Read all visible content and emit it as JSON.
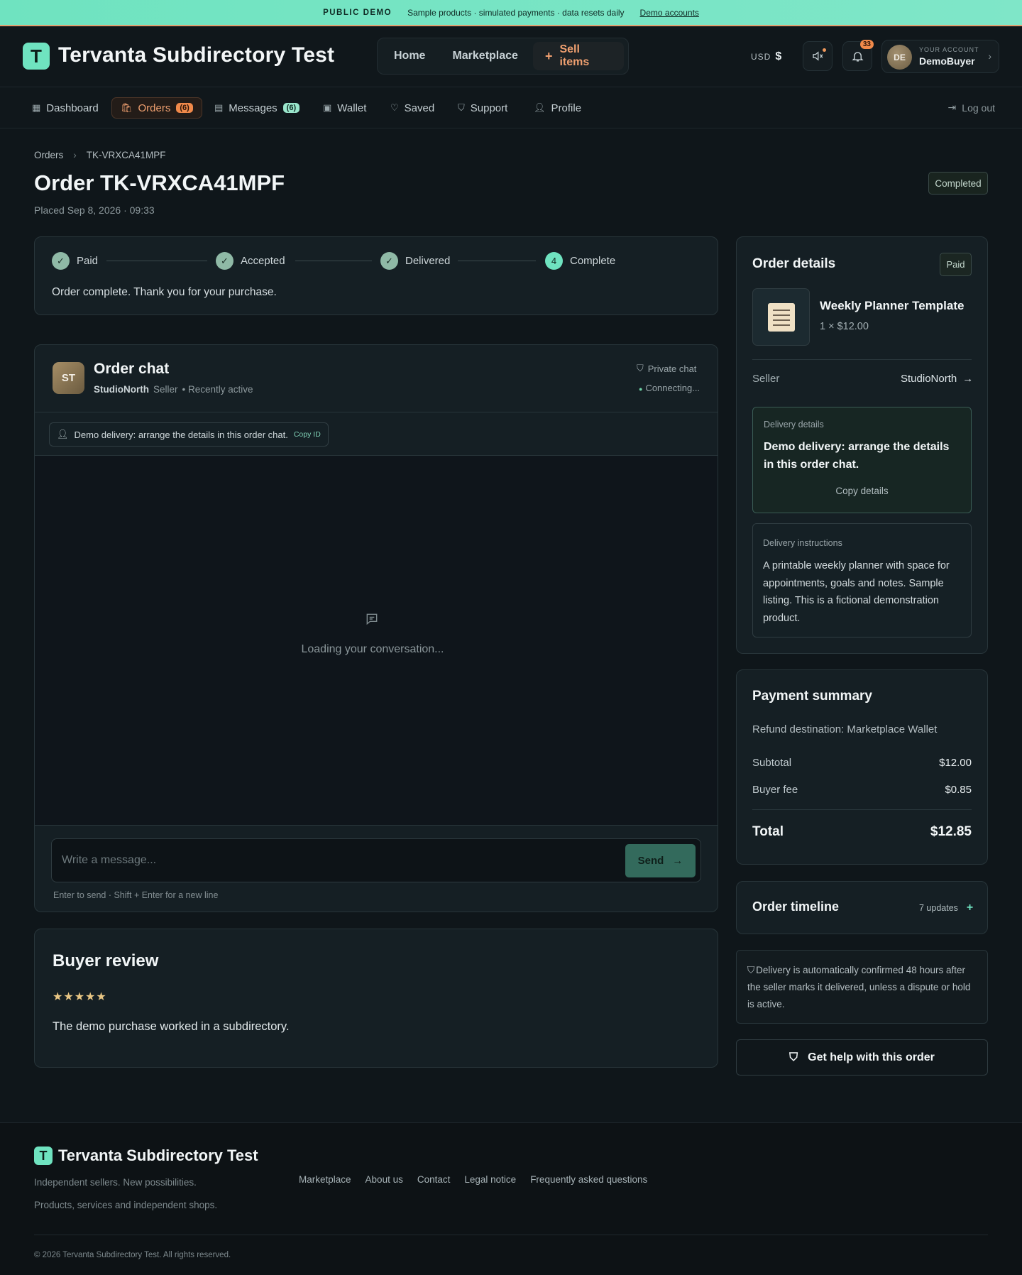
{
  "banner": {
    "tag": "PUBLIC DEMO",
    "text": "Sample products · simulated payments · data resets daily",
    "link": "Demo accounts"
  },
  "header": {
    "logo_letter": "T",
    "brand": "Tervanta Subdirectory Test",
    "nav": {
      "home": "Home",
      "marketplace": "Marketplace",
      "sell": "Sell items"
    },
    "currency_code": "USD",
    "currency_symbol": "$",
    "notifications_count": "33",
    "account": {
      "initials": "DE",
      "label": "YOUR ACCOUNT",
      "name": "DemoBuyer"
    }
  },
  "subnav": {
    "dashboard": "Dashboard",
    "orders": "Orders",
    "orders_count": "(6)",
    "messages": "Messages",
    "messages_count": "(6)",
    "wallet": "Wallet",
    "saved": "Saved",
    "support": "Support",
    "profile": "Profile",
    "logout": "Log out"
  },
  "breadcrumb": {
    "root": "Orders",
    "current": "TK-VRXCA41MPF"
  },
  "order": {
    "title": "Order TK-VRXCA41MPF",
    "placed": "Placed Sep 8, 2026 · 09:33",
    "status": "Completed"
  },
  "progress": {
    "steps": [
      {
        "label": "Paid",
        "mark": "✓"
      },
      {
        "label": "Accepted",
        "mark": "✓"
      },
      {
        "label": "Delivered",
        "mark": "✓"
      },
      {
        "label": "Complete",
        "mark": "4"
      }
    ],
    "message": "Order complete. Thank you for your purchase."
  },
  "chat": {
    "avatar_initials": "ST",
    "title": "Order chat",
    "seller_name": "StudioNorth",
    "seller_role": "Seller",
    "activity": "• Recently active",
    "private_label": "Private chat",
    "connection_status": "Connecting...",
    "delivery_chip": "Demo delivery: arrange the details in this order chat.",
    "copy_id": "Copy ID",
    "loading": "Loading your conversation...",
    "input_placeholder": "Write a message...",
    "send": "Send",
    "hint": "Enter to send · Shift + Enter for a new line"
  },
  "review": {
    "title": "Buyer review",
    "stars": "★★★★★",
    "rating": 5,
    "text": "The demo purchase worked in a subdirectory."
  },
  "order_details": {
    "title": "Order details",
    "payment_badge": "Paid",
    "product_name": "Weekly Planner Template",
    "product_qty": "1 × $12.00",
    "seller_label": "Seller",
    "seller_value": "StudioNorth",
    "delivery_details_label": "Delivery details",
    "delivery_details_text": "Demo delivery: arrange the details in this order chat.",
    "copy_details": "Copy details",
    "delivery_instructions_label": "Delivery instructions",
    "delivery_instructions_text": "A printable weekly planner with space for appointments, goals and notes. Sample listing. This is a fictional demonstration product."
  },
  "payment_summary": {
    "title": "Payment summary",
    "refund": "Refund destination: Marketplace Wallet",
    "subtotal_label": "Subtotal",
    "subtotal": "$12.00",
    "fee_label": "Buyer fee",
    "fee": "$0.85",
    "total_label": "Total",
    "total": "$12.85"
  },
  "timeline": {
    "title": "Order timeline",
    "count": "7 updates"
  },
  "auto_confirm": "Delivery is automatically confirmed 48 hours after the seller marks it delivered, unless a dispute or hold is active.",
  "help_button": "Get help with this order",
  "footer": {
    "logo_letter": "T",
    "brand": "Tervanta Subdirectory Test",
    "tagline1": "Independent sellers. New possibilities.",
    "tagline2": "Products, services and independent shops.",
    "links": [
      "Marketplace",
      "About us",
      "Contact",
      "Legal notice",
      "Frequently asked questions"
    ],
    "copyright": "© 2026 Tervanta Subdirectory Test. All rights reserved."
  },
  "colors": {
    "accent": "#6fe3c0",
    "orange": "#f0894a",
    "background": "#0f161a",
    "card": "#151f24"
  }
}
